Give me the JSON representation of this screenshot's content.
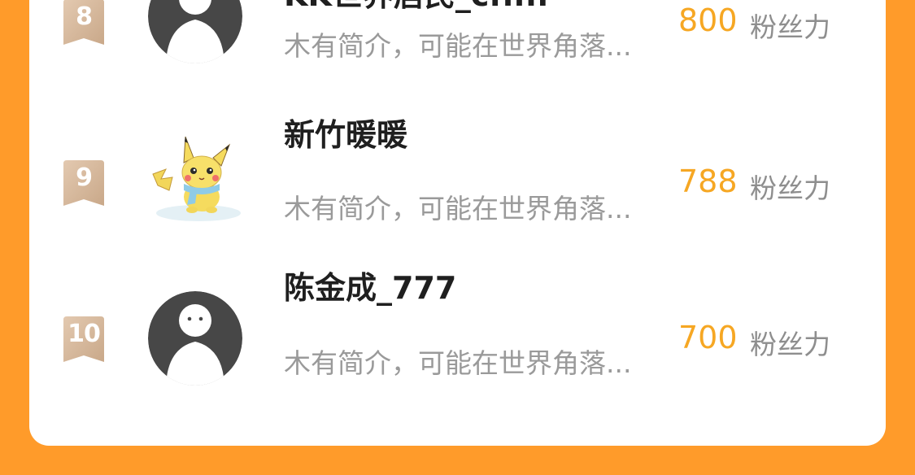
{
  "leaderboard": {
    "entries": [
      {
        "rank": "8",
        "name": "KK世界居民_cfr...",
        "bio": "木有简介，可能在世界角落...",
        "score": "800",
        "score_unit": "粉丝力",
        "avatar": "default-person-icon"
      },
      {
        "rank": "9",
        "name": "新竹暖暖",
        "bio": "木有简介，可能在世界角落...",
        "score": "788",
        "score_unit": "粉丝力",
        "avatar": "pikachu-avatar"
      },
      {
        "rank": "10",
        "name": "陈金成_777",
        "bio": "木有简介，可能在世界角落...",
        "score": "700",
        "score_unit": "粉丝力",
        "avatar": "default-person-icon"
      }
    ]
  },
  "colors": {
    "background": "#FF9B2A",
    "card": "#FFFFFF",
    "score": "#F6A723",
    "rank_badge": "#D4B79C",
    "name": "#1F1F1F",
    "muted": "#9A9A9A"
  }
}
